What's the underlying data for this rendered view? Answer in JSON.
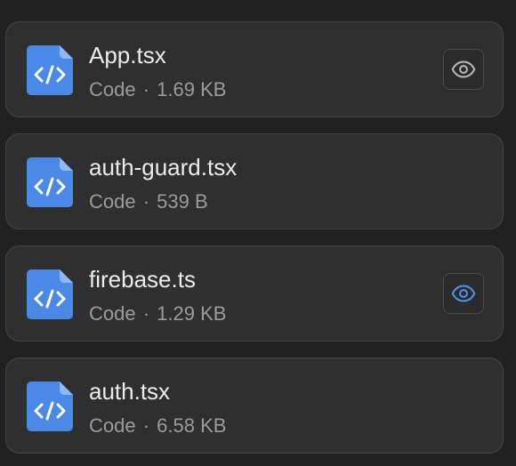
{
  "colors": {
    "icon_blue": "#4a8ae6",
    "eye_default": "#b4b4b4",
    "eye_active": "#4a90e8"
  },
  "files": [
    {
      "name": "App.tsx",
      "type": "Code",
      "separator": "·",
      "size": "1.69 KB",
      "icon": "code-file-icon",
      "preview": "eye-icon",
      "preview_active": false
    },
    {
      "name": "auth-guard.tsx",
      "type": "Code",
      "separator": "·",
      "size": "539 B",
      "icon": "code-file-icon"
    },
    {
      "name": "firebase.ts",
      "type": "Code",
      "separator": "·",
      "size": "1.29 KB",
      "icon": "code-file-icon",
      "preview": "eye-icon",
      "preview_active": true
    },
    {
      "name": "auth.tsx",
      "type": "Code",
      "separator": "·",
      "size": "6.58 KB",
      "icon": "code-file-icon"
    }
  ]
}
